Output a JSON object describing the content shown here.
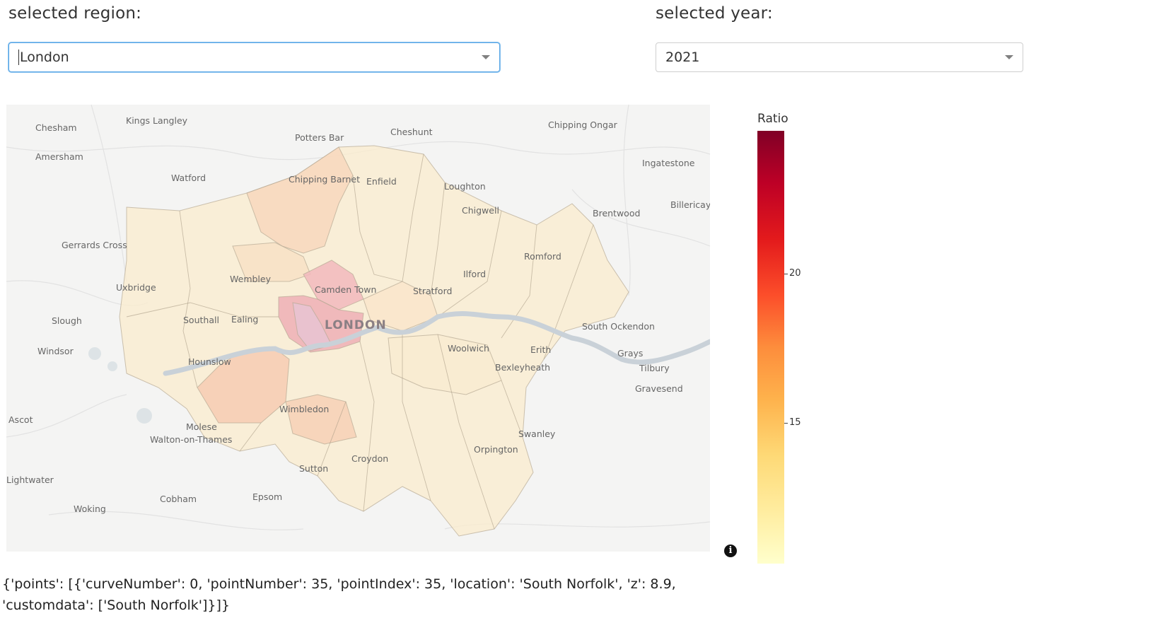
{
  "region_control": {
    "label": "selected region:",
    "value": "London"
  },
  "year_control": {
    "label": "selected year:",
    "value": "2021"
  },
  "map": {
    "center_label": "LONDON",
    "place_labels": [
      "Chesham",
      "Kings Langley",
      "Potters Bar",
      "Cheshunt",
      "Chipping Ongar",
      "Amersham",
      "Watford",
      "Chipping Barnet",
      "Enfield",
      "Loughton",
      "Ingatestone",
      "Chigwell",
      "Brentwood",
      "Billericay",
      "Gerrards Cross",
      "Romford",
      "Wembley",
      "Camden Town",
      "Ilford",
      "Uxbridge",
      "Stratford",
      "Slough",
      "Southall",
      "Ealing",
      "South Ockendon",
      "Windsor",
      "Woolwich",
      "Erith",
      "Grays",
      "Hounslow",
      "Bexleyheath",
      "Tilbury",
      "Gravesend",
      "Wimbledon",
      "Ascot",
      "Molese",
      "Walton-on-Thames",
      "Swanley",
      "Orpington",
      "Croydon",
      "Sutton",
      "Lightwater",
      "Cobham",
      "Epsom",
      "Woking"
    ],
    "info_icon": "info-icon"
  },
  "colorbar": {
    "title": "Ratio",
    "colorscale": "YlOrRd",
    "ticks": [
      "20",
      "15"
    ],
    "range": [
      10,
      27
    ]
  },
  "click_output": {
    "text": "{'points': [{'curveNumber': 0, 'pointNumber': 35, 'pointIndex': 35, 'location': 'South Norfolk', 'z': 8.9,\n'customdata': ['South Norfolk']}]}"
  },
  "colors": {
    "dropdown_focus": "#5aa7e6",
    "map_background": "#f4f4f3",
    "low_ratio_fill": "#fbeccd",
    "mid_ratio_fill": "#f6c9b0",
    "high_ratio_fill": "#efb3b8",
    "thames": "#c9d1d8"
  }
}
